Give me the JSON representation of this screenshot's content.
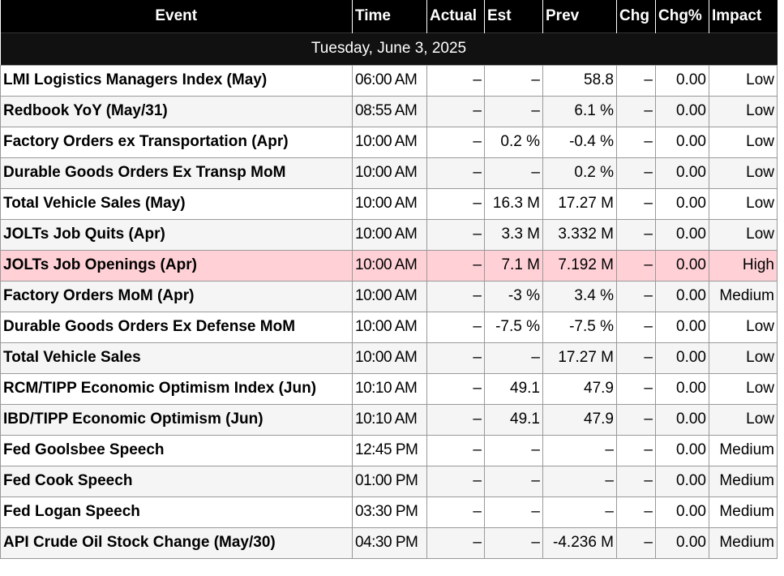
{
  "headers": {
    "event": "Event",
    "time": "Time",
    "actual": "Actual",
    "est": "Est",
    "prev": "Prev",
    "chg": "Chg",
    "chgp": "Chg%",
    "impact": "Impact"
  },
  "date_label": "Tuesday, June 3, 2025",
  "colors": {
    "header_bg": "#000000",
    "high_impact_row": "#ffd1d6"
  },
  "rows": [
    {
      "event": "LMI Logistics Managers Index (May)",
      "time": "06:00 AM",
      "actual": "–",
      "est": "–",
      "prev": "58.8",
      "chg": "–",
      "chgp": "0.00",
      "impact": "Low"
    },
    {
      "event": "Redbook YoY (May/31)",
      "time": "08:55 AM",
      "actual": "–",
      "est": "–",
      "prev": "6.1 %",
      "chg": "–",
      "chgp": "0.00",
      "impact": "Low"
    },
    {
      "event": "Factory Orders ex Transportation (Apr)",
      "time": "10:00 AM",
      "actual": "–",
      "est": "0.2 %",
      "prev": "-0.4 %",
      "chg": "–",
      "chgp": "0.00",
      "impact": "Low"
    },
    {
      "event": "Durable Goods Orders Ex Transp MoM",
      "time": "10:00 AM",
      "actual": "–",
      "est": "–",
      "prev": "0.2 %",
      "chg": "–",
      "chgp": "0.00",
      "impact": "Low"
    },
    {
      "event": "Total Vehicle Sales (May)",
      "time": "10:00 AM",
      "actual": "–",
      "est": "16.3 M",
      "prev": "17.27 M",
      "chg": "–",
      "chgp": "0.00",
      "impact": "Low"
    },
    {
      "event": "JOLTs Job Quits (Apr)",
      "time": "10:00 AM",
      "actual": "–",
      "est": "3.3 M",
      "prev": "3.332 M",
      "chg": "–",
      "chgp": "0.00",
      "impact": "Low"
    },
    {
      "event": "JOLTs Job Openings (Apr)",
      "time": "10:00 AM",
      "actual": "–",
      "est": "7.1 M",
      "prev": "7.192 M",
      "chg": "–",
      "chgp": "0.00",
      "impact": "High"
    },
    {
      "event": "Factory Orders MoM (Apr)",
      "time": "10:00 AM",
      "actual": "–",
      "est": "-3 %",
      "prev": "3.4 %",
      "chg": "–",
      "chgp": "0.00",
      "impact": "Medium"
    },
    {
      "event": "Durable Goods Orders Ex Defense MoM",
      "time": "10:00 AM",
      "actual": "–",
      "est": "-7.5 %",
      "prev": "-7.5 %",
      "chg": "–",
      "chgp": "0.00",
      "impact": "Low"
    },
    {
      "event": "Total Vehicle Sales",
      "time": "10:00 AM",
      "actual": "–",
      "est": "–",
      "prev": "17.27 M",
      "chg": "–",
      "chgp": "0.00",
      "impact": "Low"
    },
    {
      "event": "RCM/TIPP Economic Optimism Index (Jun)",
      "time": "10:10 AM",
      "actual": "–",
      "est": "49.1",
      "prev": "47.9",
      "chg": "–",
      "chgp": "0.00",
      "impact": "Low"
    },
    {
      "event": "IBD/TIPP Economic Optimism (Jun)",
      "time": "10:10 AM",
      "actual": "–",
      "est": "49.1",
      "prev": "47.9",
      "chg": "–",
      "chgp": "0.00",
      "impact": "Low"
    },
    {
      "event": "Fed Goolsbee Speech",
      "time": "12:45 PM",
      "actual": "–",
      "est": "–",
      "prev": "–",
      "chg": "–",
      "chgp": "0.00",
      "impact": "Medium"
    },
    {
      "event": "Fed Cook Speech",
      "time": "01:00 PM",
      "actual": "–",
      "est": "–",
      "prev": "–",
      "chg": "–",
      "chgp": "0.00",
      "impact": "Medium"
    },
    {
      "event": "Fed Logan Speech",
      "time": "03:30 PM",
      "actual": "–",
      "est": "–",
      "prev": "–",
      "chg": "–",
      "chgp": "0.00",
      "impact": "Medium"
    },
    {
      "event": "API Crude Oil Stock Change (May/30)",
      "time": "04:30 PM",
      "actual": "–",
      "est": "–",
      "prev": "-4.236 M",
      "chg": "–",
      "chgp": "0.00",
      "impact": "Medium"
    }
  ]
}
